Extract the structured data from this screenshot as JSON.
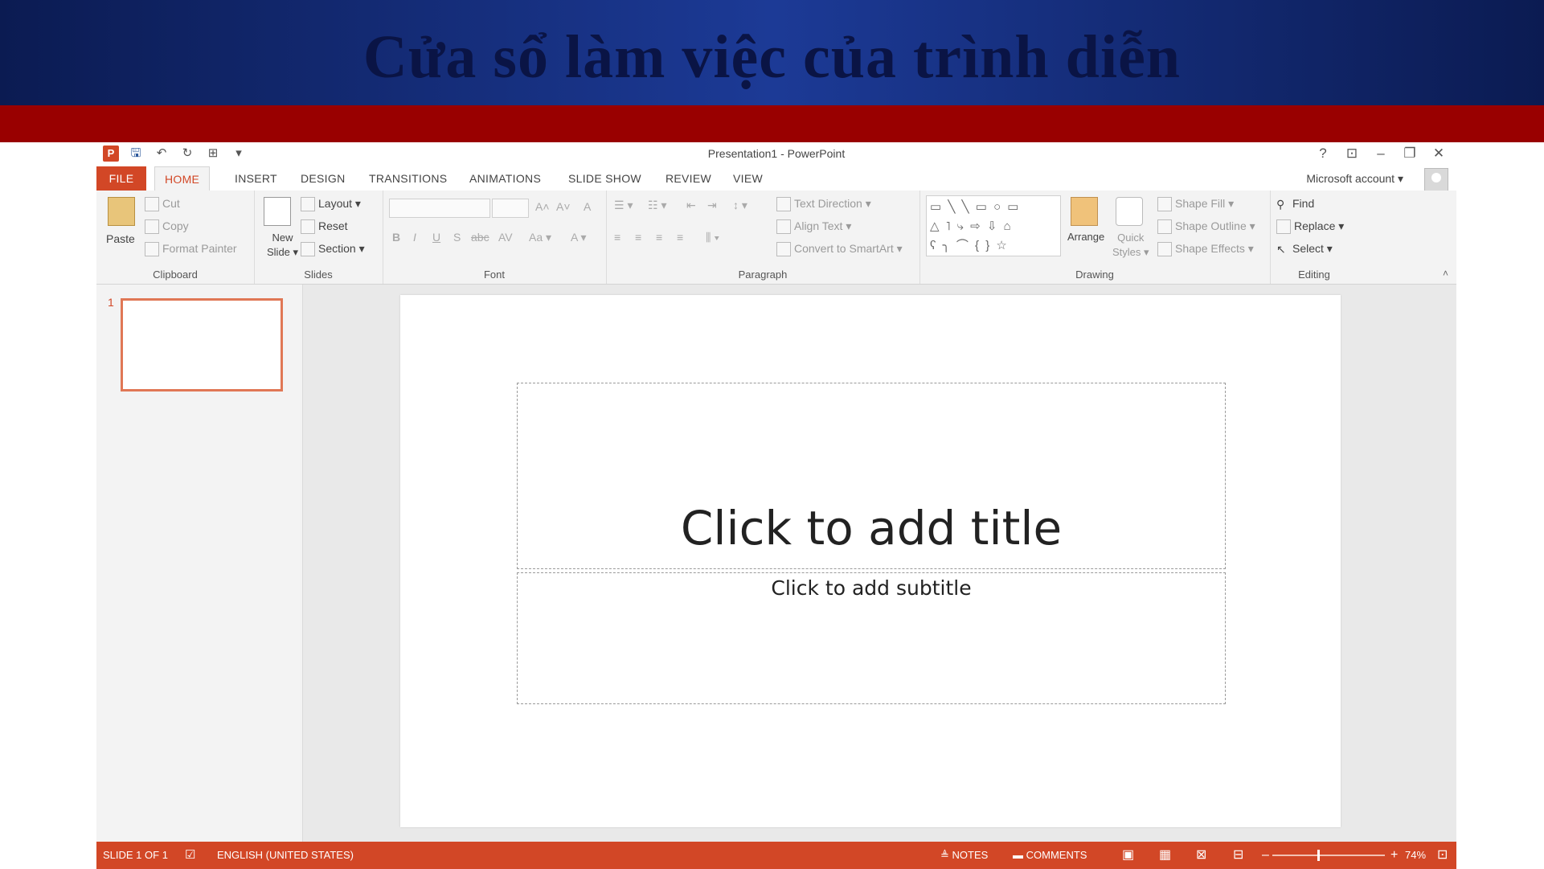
{
  "banner": {
    "title": "Cửa sổ làm việc của trình diễn"
  },
  "window": {
    "title": "Presentation1 - PowerPoint",
    "controls": {
      "help": "?",
      "ribbon_options": "⊡",
      "minimize": "–",
      "restore": "❐",
      "close": "✕"
    }
  },
  "qat": {
    "logo": "P",
    "save": "🖫",
    "undo": "↶",
    "redo": "↻",
    "present": "⊞",
    "more": "▾"
  },
  "tabs": {
    "file": "FILE",
    "home": "HOME",
    "insert": "INSERT",
    "design": "DESIGN",
    "transitions": "TRANSITIONS",
    "animations": "ANIMATIONS",
    "slideshow": "SLIDE SHOW",
    "review": "REVIEW",
    "view": "VIEW"
  },
  "account": {
    "name": "Microsoft account",
    "arrow": "▾"
  },
  "ribbon": {
    "clipboard": {
      "label": "Clipboard",
      "paste": "Paste",
      "cut": "Cut",
      "copy": "Copy",
      "format_painter": "Format Painter"
    },
    "slides": {
      "label": "Slides",
      "new_slide_line1": "New",
      "new_slide_line2": "Slide ▾",
      "layout": "Layout ▾",
      "reset": "Reset",
      "section": "Section ▾"
    },
    "font": {
      "label": "Font",
      "bold": "B",
      "italic": "I",
      "underline": "U",
      "shadow": "S",
      "strike": "abc",
      "spacing": "AV",
      "case": "Aa ▾",
      "color": "A ▾",
      "grow": "A˄",
      "shrink": "A˅",
      "clear": "A"
    },
    "paragraph": {
      "label": "Paragraph",
      "text_direction": "Text Direction ▾",
      "align_text": "Align Text ▾",
      "convert_smartart": "Convert to SmartArt ▾"
    },
    "drawing": {
      "label": "Drawing",
      "arrange": "Arrange",
      "quick_styles_line1": "Quick",
      "quick_styles_line2": "Styles ▾",
      "shape_fill": "Shape Fill ▾",
      "shape_outline": "Shape Outline ▾",
      "shape_effects": "Shape Effects ▾",
      "shapes_row1": "▭ ╲ ╲ ▭ ○ ▭",
      "shapes_row2": "△ ˥ ⤷ ⇨ ⇩ ⌂",
      "shapes_row3": "ʕ ╮ ⌒ { } ☆"
    },
    "editing": {
      "label": "Editing",
      "find": "Find",
      "replace": "Replace ▾",
      "select": "Select ▾"
    },
    "collapse": "˄"
  },
  "thumbnails": {
    "slide_number": "1"
  },
  "slide": {
    "title_placeholder": "Click to add title",
    "subtitle_placeholder": "Click to add subtitle"
  },
  "status": {
    "slide_info": "SLIDE 1 OF 1",
    "language": "ENGLISH (UNITED STATES)",
    "notes": "≜ NOTES",
    "comments": "▬ COMMENTS",
    "zoom": "74%",
    "view_normal": "▣",
    "view_sorter": "▦",
    "view_reading": "⊠",
    "view_slideshow": "⊟",
    "zoom_out": "–",
    "zoom_in": "+",
    "fit": "⊡"
  },
  "colors": {
    "accent": "#d24726",
    "banner": "#1c3a96",
    "redbar": "#990000"
  }
}
